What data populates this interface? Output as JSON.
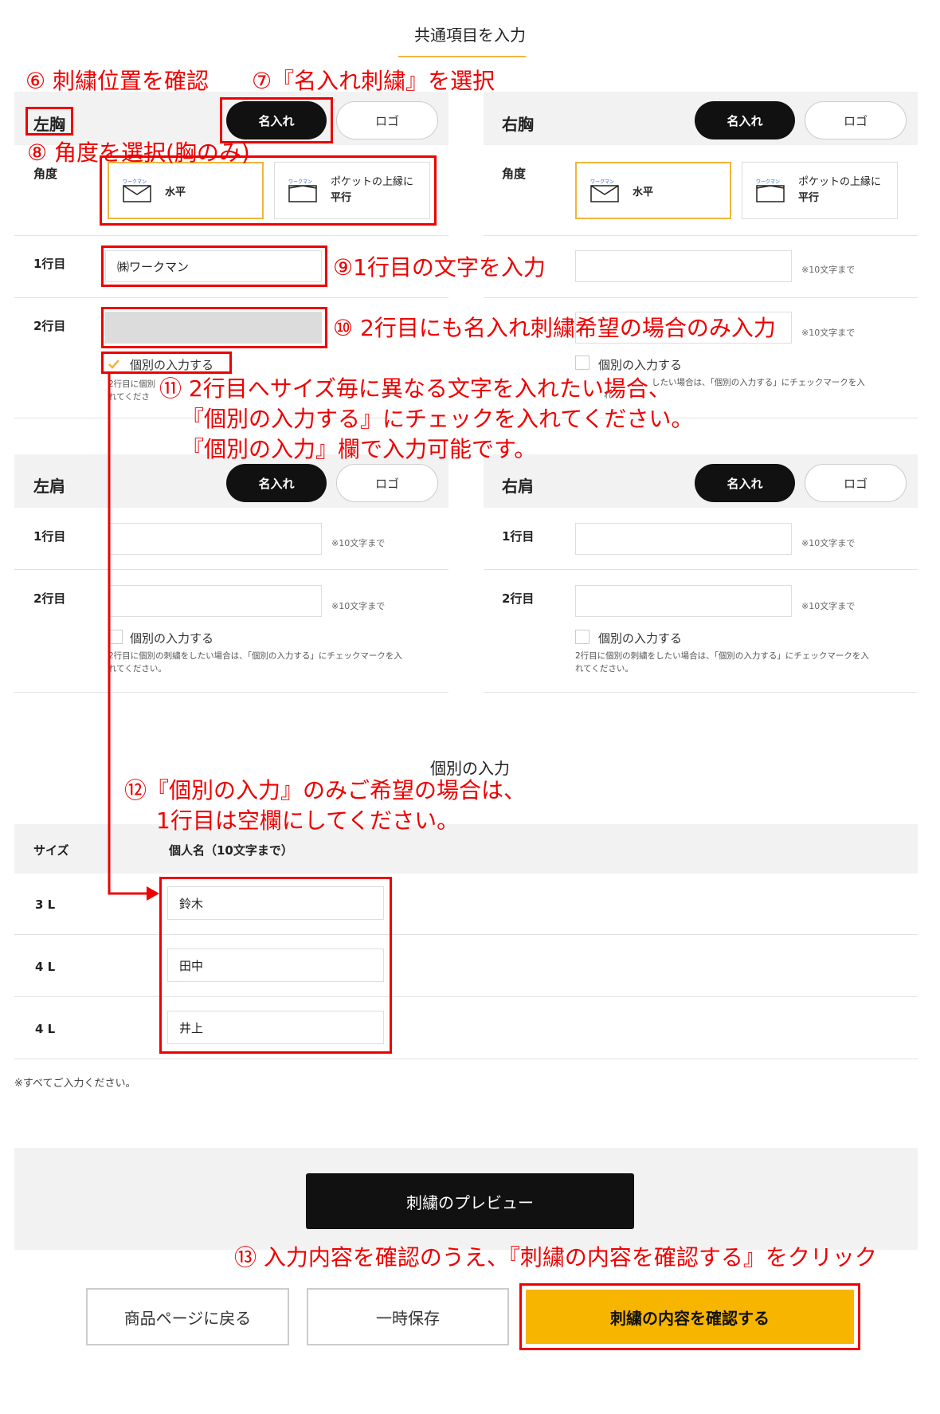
{
  "page_title": "共通項目を入力",
  "labels": {
    "angle": "角度",
    "line1": "1行目",
    "line2": "2行目",
    "individual_checkbox": "個別の入力する",
    "char_limit": "※10文字まで",
    "individual_note": "2行目に個別の刺繍をしたい場合は、「個別の入力する」にチェックマークを入れてください。",
    "embroidery_toggle": "名入れ",
    "logo_toggle": "ロゴ"
  },
  "left_chest": {
    "label": "左胸",
    "angle_options": [
      {
        "brand": "ワークマン",
        "label": "水平",
        "selected": true
      },
      {
        "brand": "ワークマン",
        "label_top": "ポケットの上縁に",
        "label": "平行",
        "selected": false
      }
    ],
    "line1_value": "㈱ワークマン",
    "line2_value": "",
    "individual_checked": true,
    "individual_note_visible": "2行目に個別\nれてくださ"
  },
  "right_chest": {
    "label": "右胸",
    "angle_options": [
      {
        "brand": "ワークマン",
        "label": "水平",
        "selected": true
      },
      {
        "brand": "ワークマン",
        "label_top": "ポケットの上縁に",
        "label": "平行",
        "selected": false
      }
    ],
    "line1_value": "",
    "line2_value": "",
    "individual_checked": false,
    "individual_note_visible": "したい場合は、「個別の入力する」にチェックマークを入",
    "individual_note_line2": "れ"
  },
  "left_shoulder": {
    "label": "左肩",
    "line1_value": "",
    "line2_value": "",
    "individual_checked": false,
    "individual_note_line1": "2行目に個別の刺繍をしたい場合は、「個別の入力する」にチェックマークを入",
    "individual_note_line2": "れてください。"
  },
  "right_shoulder": {
    "label": "右肩",
    "line1_value": "",
    "line2_value": "",
    "individual_checked": false,
    "individual_note_line1": "2行目に個別の刺繍をしたい場合は、「個別の入力する」にチェックマークを入",
    "individual_note_line2": "れてください。"
  },
  "individual_section": {
    "title": "個別の入力",
    "col_size": "サイズ",
    "col_name": "個人名（10文字まで）",
    "rows": [
      {
        "size": "3 L",
        "name": "鈴木"
      },
      {
        "size": "4 L",
        "name": "田中"
      },
      {
        "size": "4 L",
        "name": "井上"
      }
    ],
    "footnote": "※すべてご入力ください。"
  },
  "buttons": {
    "preview": "刺繍のプレビュー",
    "back": "商品ページに戻る",
    "save": "一時保存",
    "confirm": "刺繍の内容を確認する"
  },
  "annotations": {
    "a6": "⑥ 刺繍位置を確認",
    "a7": "⑦『名入れ刺繍』を選択",
    "a8": "⑧ 角度を選択(胸のみ)",
    "a9": "⑨1行目の文字を入力",
    "a10": "⑩ 2行目にも名入れ刺繍希望の場合のみ入力",
    "a11_1": "⑪ 2行目へサイズ毎に異なる文字を入れたい場合、",
    "a11_2": "『個別の入力する』にチェックを入れてください。",
    "a11_3": "『個別の入力』欄で入力可能です。",
    "a12_1": "⑫『個別の入力』のみご希望の場合は、",
    "a12_2": "1行目は空欄にしてください。",
    "a13": "⑬ 入力内容を確認のうえ、『刺繍の内容を確認する』をクリック"
  },
  "colors": {
    "accent_yellow": "#f2b53a",
    "confirm_button": "#f7b500",
    "annotation_red": "#e00000",
    "dark_button": "#111111"
  }
}
